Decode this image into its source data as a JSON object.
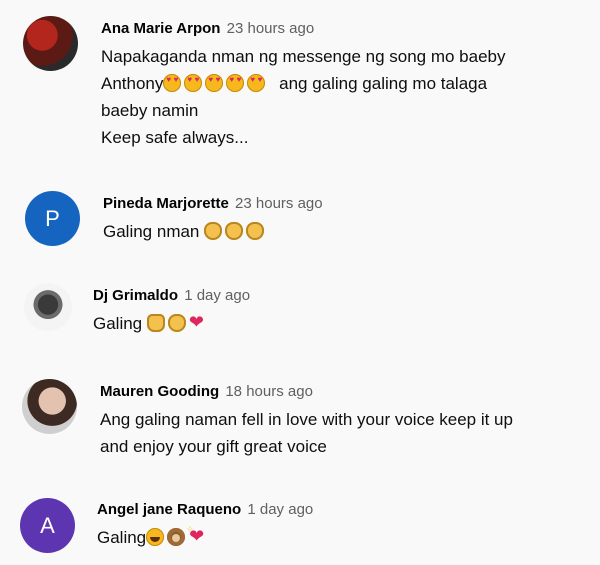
{
  "comments": [
    {
      "author": "Ana Marie Arpon",
      "time": "23 hours ago",
      "lines": [
        "Napakaganda nman ng messenge ng song mo baeby",
        "Anthony",
        "ang galing galing mo talaga",
        "baeby namin",
        "Keep safe always..."
      ],
      "avatar": {
        "type": "photo"
      }
    },
    {
      "author": "Pineda Marjorette",
      "time": "23 hours ago",
      "text": "Galing nman",
      "avatar": {
        "type": "letter",
        "letter": "P",
        "color": "#1565c0"
      }
    },
    {
      "author": "Dj Grimaldo",
      "time": "1 day ago",
      "text": "Galing",
      "avatar": {
        "type": "photo"
      }
    },
    {
      "author": "Mauren Gooding",
      "time": "18 hours ago",
      "lines": [
        "Ang galing naman fell in love with your voice keep it up",
        "and enjoy your gift great voice"
      ],
      "avatar": {
        "type": "photo"
      }
    },
    {
      "author": "Angel jane Raqueno",
      "time": "1 day ago",
      "text": "Galing",
      "avatar": {
        "type": "letter",
        "letter": "A",
        "color": "#5e35b1"
      }
    }
  ],
  "icons": {
    "heart_eyes": "smiling-face-with-heart-eyes-icon",
    "clap": "clapping-hands-icon",
    "thumbs_up": "thumbs-up-icon",
    "heart": "red-heart-icon",
    "grin": "grinning-squinting-face-icon",
    "monkey": "see-no-evil-monkey-icon",
    "sparkling_heart": "sparkling-heart-icon"
  }
}
